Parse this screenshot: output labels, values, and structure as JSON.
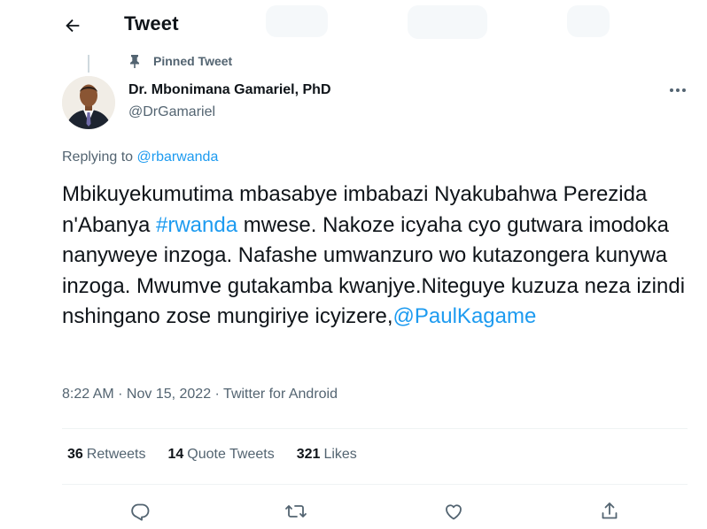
{
  "header": {
    "title": "Tweet",
    "back_icon": "arrow-left-icon"
  },
  "pinned": {
    "label": "Pinned Tweet",
    "icon": "pin-icon"
  },
  "author": {
    "name": "Dr. Mbonimana Gamariel, PhD",
    "handle": "@DrGamariel"
  },
  "reply": {
    "prefix": "Replying to",
    "handle": "@rbarwanda"
  },
  "tweet": {
    "text_1": "Mbikuyekumutima mbasabye imbabazi Nyakubahwa Perezida n'Abanya ",
    "hashtag": "#rwanda",
    "text_2": " mwese. Nakoze icyaha cyo gutwara imodoka nanyweye inzoga. Nafashe umwanzuro wo kutazongera kunywa inzoga. Mwumve gutakamba kwanjye.Niteguye kuzuza neza izindi nshingano zose mungiriye icyizere,",
    "mention": "@PaulKagame"
  },
  "meta": {
    "time": "8:22 AM",
    "sep1": " · ",
    "date": "Nov 15, 2022",
    "sep2": " · ",
    "source": "Twitter for Android"
  },
  "stats": {
    "retweets_count": "36",
    "retweets_label": "Retweets",
    "quotes_count": "14",
    "quotes_label": "Quote Tweets",
    "likes_count": "321",
    "likes_label": "Likes"
  },
  "actions": {
    "icons": [
      "reply-icon",
      "retweet-icon",
      "like-icon",
      "share-icon"
    ]
  },
  "colors": {
    "accent": "#1d9bf0",
    "text": "#0f1419",
    "secondary": "#536471",
    "divider": "#eff3f4"
  }
}
